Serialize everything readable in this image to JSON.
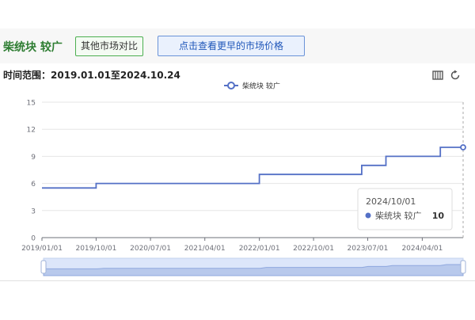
{
  "header": {
    "title": "柴统块 较广",
    "compare_button": "其他市场对比",
    "earlier_button": "点击查看更早的市场价格"
  },
  "range_label": "时间范围：2019.01.01至2024.10.24",
  "toolbar": {
    "data_view_icon": "data-view-icon",
    "restore_icon": "refresh-icon"
  },
  "tooltip": {
    "date": "2024/10/01",
    "series": "柴统块 较广",
    "value": "10"
  },
  "colors": {
    "line": "#5470c6",
    "title": "#2e7d32",
    "grid": "#e6e6e6",
    "axis": "#6e7079",
    "zoom_fill": "#dce6fa"
  },
  "chart_data": {
    "type": "line",
    "step": true,
    "legend": {
      "position": "top-center",
      "entries": [
        "柴统块 较广"
      ]
    },
    "xlim": [
      "2019-01-01",
      "2024-10-24"
    ],
    "ylim": [
      0,
      15
    ],
    "y_ticks": [
      0,
      3,
      6,
      9,
      12,
      15
    ],
    "x_ticks": [
      "2019/01/01",
      "2019/10/01",
      "2020/07/01",
      "2021/04/01",
      "2022/01/01",
      "2022/10/01",
      "2023/07/01",
      "2024/04/01"
    ],
    "grid": true,
    "series": [
      {
        "name": "柴统块 较广",
        "points": [
          [
            "2019-01-01",
            5.5
          ],
          [
            "2019-10-01",
            5.5
          ],
          [
            "2019-11-01",
            6
          ],
          [
            "2022-01-01",
            6
          ],
          [
            "2022-02-01",
            7
          ],
          [
            "2023-06-01",
            7
          ],
          [
            "2023-07-01",
            8
          ],
          [
            "2023-10-01",
            8
          ],
          [
            "2023-11-01",
            9
          ],
          [
            "2024-07-01",
            9
          ],
          [
            "2024-08-01",
            10
          ],
          [
            "2024-10-01",
            10
          ]
        ]
      }
    ]
  }
}
